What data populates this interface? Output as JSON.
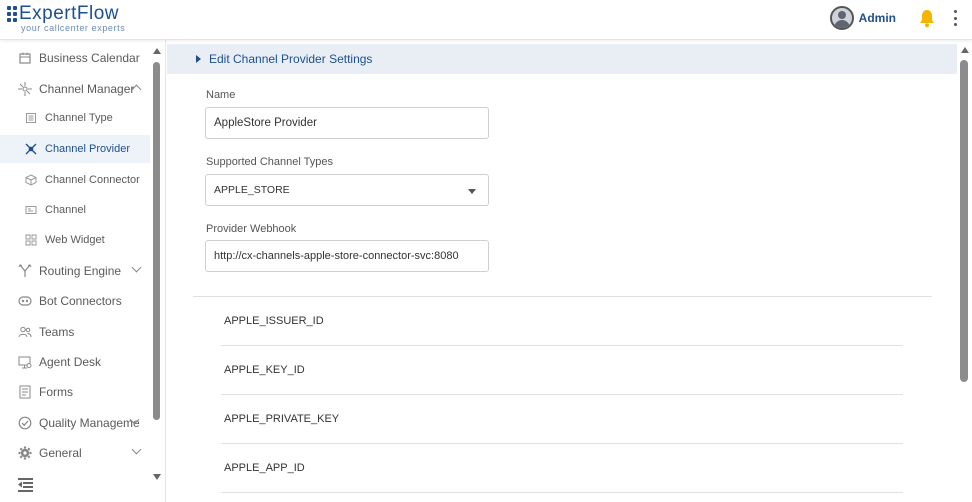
{
  "app": {
    "logo_text": "ExpertFlow",
    "logo_tagline": "your callcenter experts"
  },
  "header": {
    "user_name": "Admin",
    "icons": [
      "avatar-icon",
      "bell-icon",
      "kebab-menu-icon"
    ],
    "bell_color": "#f5b400"
  },
  "sidebar": {
    "items": [
      {
        "label": "Business Calendar",
        "icon": "calendar-icon"
      },
      {
        "label": "Channel Manager",
        "icon": "channel-manager-icon",
        "expanded": true
      },
      {
        "label": "Channel Type",
        "icon": "channel-type-icon"
      },
      {
        "label": "Channel Provider",
        "icon": "channel-provider-icon",
        "active": true
      },
      {
        "label": "Channel Connector",
        "icon": "channel-connector-icon"
      },
      {
        "label": "Channel",
        "icon": "channel-icon"
      },
      {
        "label": "Web Widget",
        "icon": "web-widget-icon"
      },
      {
        "label": "Routing Engine",
        "icon": "routing-engine-icon"
      },
      {
        "label": "Bot Connectors",
        "icon": "bot-icon"
      },
      {
        "label": "Teams",
        "icon": "teams-icon"
      },
      {
        "label": "Agent Desk",
        "icon": "agent-desk-icon"
      },
      {
        "label": "Forms",
        "icon": "forms-icon"
      },
      {
        "label": "Quality Manageme",
        "icon": "quality-icon"
      },
      {
        "label": "General",
        "icon": "gear-icon"
      }
    ]
  },
  "main": {
    "section_title": "Edit Channel Provider Settings",
    "fields": {
      "name_label": "Name",
      "name_value": "AppleStore Provider",
      "channel_types_label": "Supported Channel Types",
      "channel_types_value": "APPLE_STORE",
      "webhook_label": "Provider Webhook",
      "webhook_value": "http://cx-channels-apple-store-connector-svc:8080"
    },
    "keys": [
      "APPLE_ISSUER_ID",
      "APPLE_KEY_ID",
      "APPLE_PRIVATE_KEY",
      "APPLE_APP_ID"
    ]
  },
  "colors": {
    "brand": "#1f4f91",
    "section_bg": "#e9eef5",
    "active_bg": "#eef3fa"
  }
}
